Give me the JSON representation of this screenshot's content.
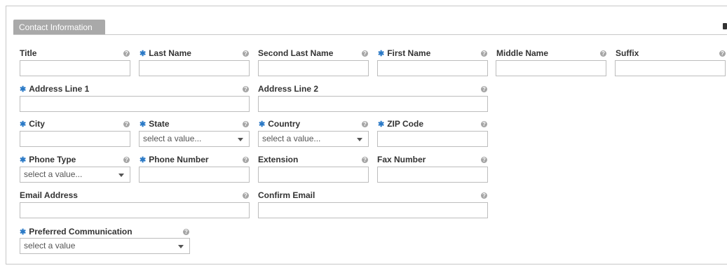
{
  "section": {
    "tab_label": "Contact Information"
  },
  "fields": {
    "title": {
      "label": "Title",
      "required": false
    },
    "last_name": {
      "label": "Last Name",
      "required": true
    },
    "second_last_name": {
      "label": "Second Last Name",
      "required": false
    },
    "first_name": {
      "label": "First Name",
      "required": true
    },
    "middle_name": {
      "label": "Middle Name",
      "required": false
    },
    "suffix": {
      "label": "Suffix",
      "required": false
    },
    "address_line_1": {
      "label": "Address Line 1",
      "required": true
    },
    "address_line_2": {
      "label": "Address Line 2",
      "required": false
    },
    "city": {
      "label": "City",
      "required": true
    },
    "state": {
      "label": "State",
      "required": true,
      "value": "select a value..."
    },
    "country": {
      "label": "Country",
      "required": true,
      "value": "select a value..."
    },
    "zip_code": {
      "label": "ZIP Code",
      "required": true
    },
    "phone_type": {
      "label": "Phone Type",
      "required": true,
      "value": "select a value..."
    },
    "phone_number": {
      "label": "Phone Number",
      "required": true
    },
    "extension": {
      "label": "Extension",
      "required": false
    },
    "fax_number": {
      "label": "Fax Number",
      "required": false
    },
    "email_address": {
      "label": "Email Address",
      "required": false
    },
    "confirm_email": {
      "label": "Confirm Email",
      "required": false
    },
    "preferred_communication": {
      "label": "Preferred Communication",
      "required": true,
      "value": "select a value"
    }
  },
  "icons": {
    "required_marker": "✱",
    "help_icon": "?"
  },
  "colors": {
    "required": "#2a79c6",
    "tab_bg": "#a9a9a9"
  }
}
